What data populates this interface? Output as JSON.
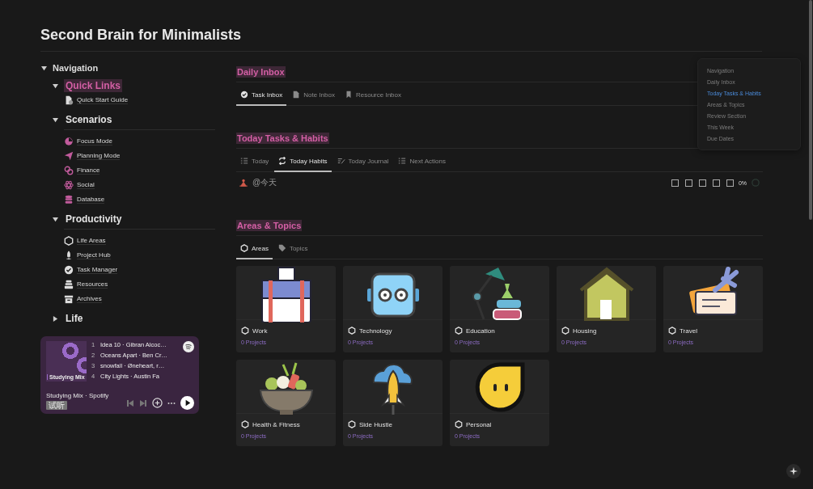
{
  "page": {
    "title": "Second Brain for Minimalists"
  },
  "navigation": {
    "label": "Navigation",
    "expanded": true,
    "children": [
      {
        "label": "Quick Links",
        "expanded": true,
        "highlighted": true,
        "children": [
          {
            "label": "Quick Start Guide"
          }
        ]
      },
      {
        "label": "Scenarios",
        "expanded": true,
        "highlighted": false,
        "children": [
          {
            "label": "Focus Mode"
          },
          {
            "label": "Planning Mode"
          },
          {
            "label": "Finance"
          },
          {
            "label": "Social"
          },
          {
            "label": "Database"
          }
        ]
      },
      {
        "label": "Productivity",
        "expanded": true,
        "highlighted": false,
        "children": [
          {
            "label": "Life Areas"
          },
          {
            "label": "Project Hub"
          },
          {
            "label": "Task Manager"
          },
          {
            "label": "Resources"
          },
          {
            "label": "Archives"
          }
        ]
      },
      {
        "label": "Life",
        "expanded": false,
        "highlighted": false
      }
    ]
  },
  "player": {
    "cover_label": "Studying Mix",
    "title": "Studying Mix · Spotify",
    "badge": "试听",
    "tracks": [
      {
        "number": "1",
        "name": "Idea 10 · Gibran Alcoc…"
      },
      {
        "number": "2",
        "name": "Oceans Apart · Ben Cr…"
      },
      {
        "number": "3",
        "name": "snowfall · Øneheart, r…"
      },
      {
        "number": "4",
        "name": "City Lights · Austin Fa"
      }
    ]
  },
  "sections": [
    {
      "title": "Daily Inbox",
      "tabs": [
        {
          "label": "Task Inbox",
          "selected": true
        },
        {
          "label": "Note Inbox",
          "selected": false
        },
        {
          "label": "Resource Inbox",
          "selected": false
        }
      ]
    },
    {
      "title": "Today Tasks & Habits",
      "tabs": [
        {
          "label": "Today",
          "selected": false
        },
        {
          "label": "Today Habits",
          "selected": true
        },
        {
          "label": "Today Journal",
          "selected": false
        },
        {
          "label": "Next Actions",
          "selected": false
        }
      ],
      "habit": {
        "label": "@今天",
        "checks": [
          {
            "checked": false
          },
          {
            "checked": false
          },
          {
            "checked": false
          },
          {
            "checked": false
          },
          {
            "checked": false
          }
        ],
        "percent": "0%",
        "level": 0
      }
    },
    {
      "title": "Areas & Topics",
      "tabs": [
        {
          "label": "Areas",
          "selected": true
        },
        {
          "label": "Topics",
          "selected": false
        }
      ],
      "cards": [
        {
          "kind": "briefcase",
          "name": "Work",
          "projects": "0 Projects"
        },
        {
          "kind": "robot",
          "name": "Technology",
          "projects": "0 Projects"
        },
        {
          "kind": "lamp",
          "name": "Education",
          "projects": "0 Projects"
        },
        {
          "kind": "house",
          "name": "Housing",
          "projects": "0 Projects"
        },
        {
          "kind": "ticket",
          "name": "Travel",
          "projects": "0 Projects"
        },
        {
          "kind": "bowl",
          "name": "Health & Fitness",
          "projects": "0 Projects"
        },
        {
          "kind": "rocket",
          "name": "Side Hustle",
          "projects": "0 Projects"
        },
        {
          "kind": "face",
          "name": "Personal",
          "projects": "0 Projects"
        }
      ]
    }
  ],
  "outline": [
    {
      "label": "Navigation",
      "selected": false
    },
    {
      "label": "Daily Inbox",
      "selected": false
    },
    {
      "label": "Today Tasks & Habits",
      "selected": true
    },
    {
      "label": "Areas & Topics",
      "selected": false
    },
    {
      "label": "Review Section",
      "selected": false
    },
    {
      "label": "This Week",
      "selected": false
    },
    {
      "label": "Due Dates",
      "selected": false
    }
  ]
}
